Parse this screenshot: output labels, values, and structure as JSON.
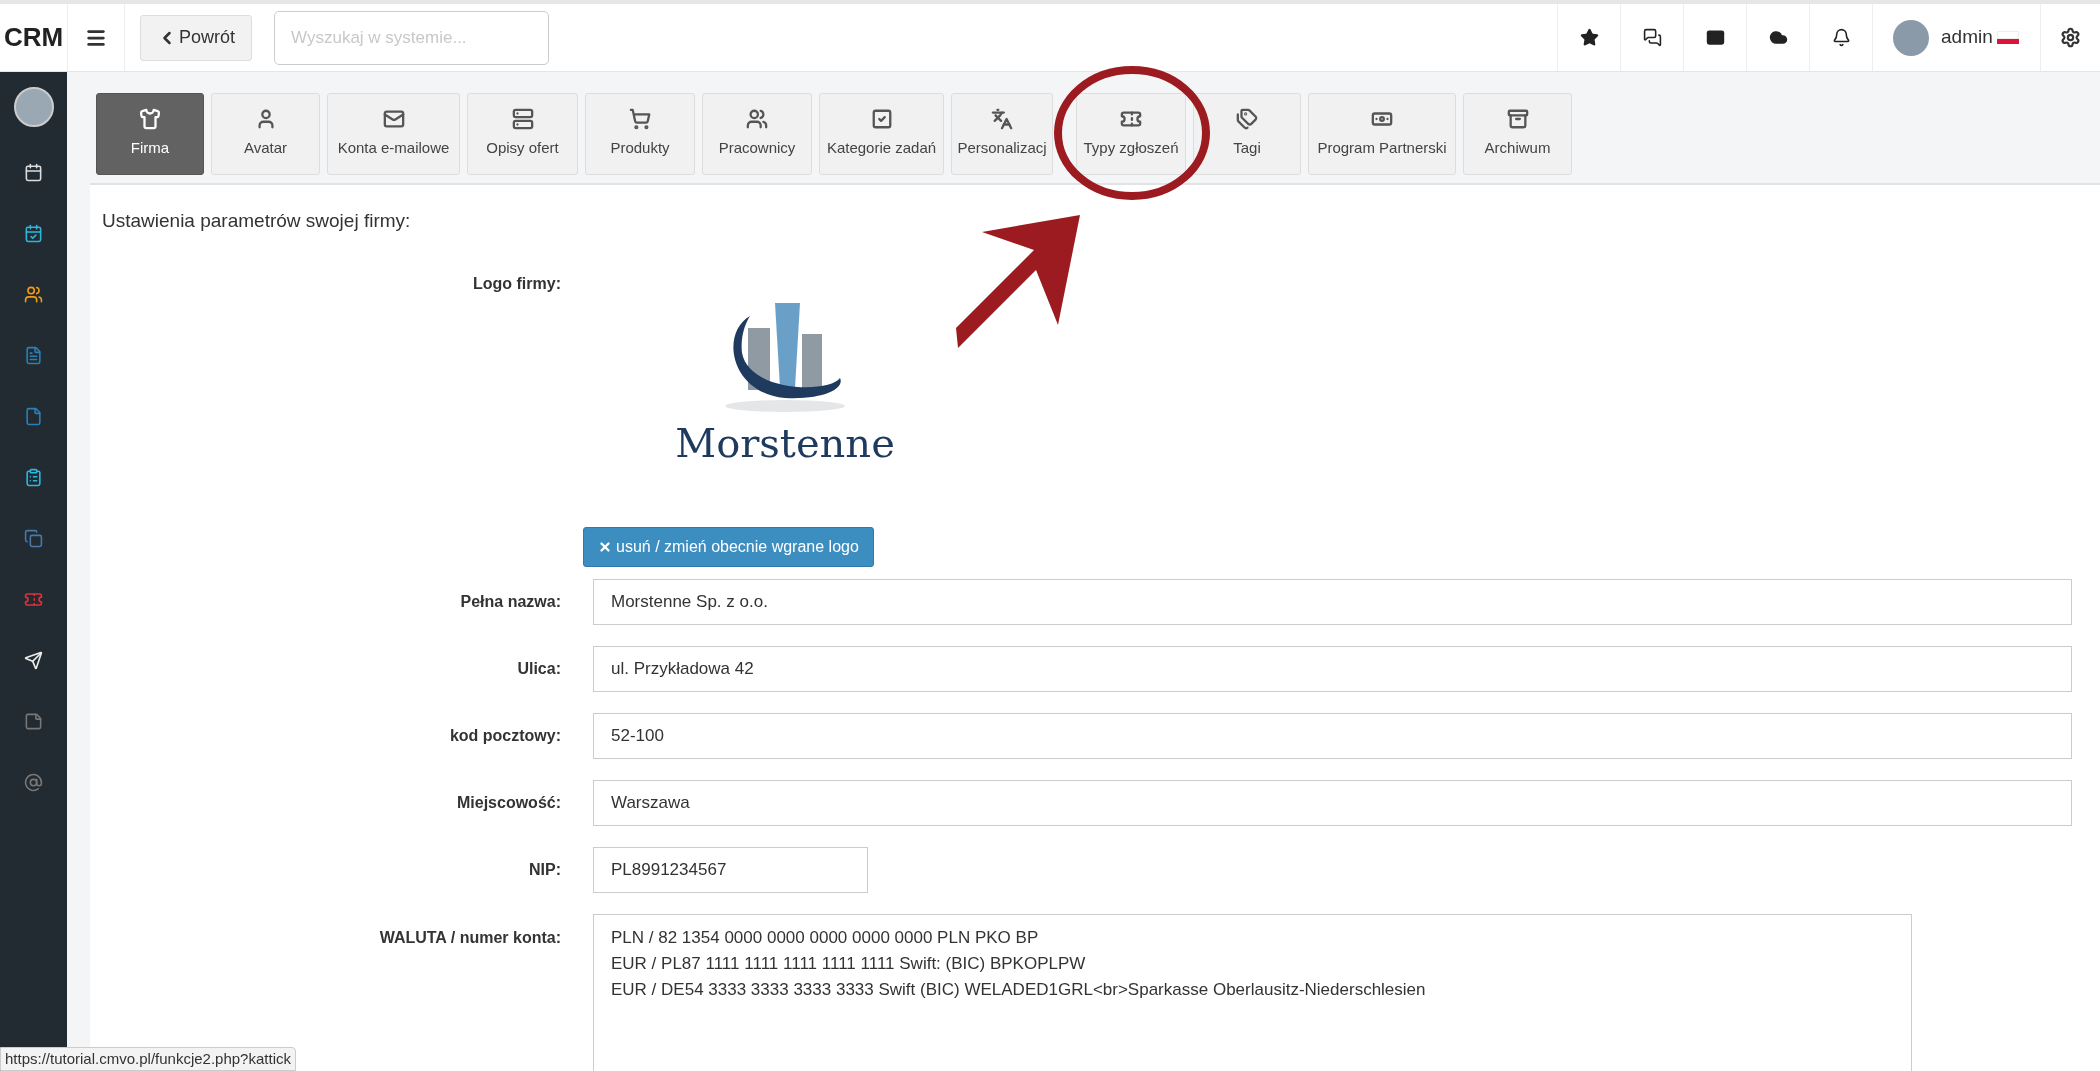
{
  "header": {
    "brand": "CRM",
    "back_button": "Powrót",
    "search": {
      "placeholder": "Wyszukaj w systemie..."
    },
    "user": {
      "name": "admin"
    }
  },
  "tabs": [
    {
      "label": "Firma",
      "selected": true
    },
    {
      "label": "Avatar",
      "selected": false
    },
    {
      "label": "Konta e-mailowe",
      "selected": false
    },
    {
      "label": "Opisy ofert",
      "selected": false
    },
    {
      "label": "Produkty",
      "selected": false
    },
    {
      "label": "Pracownicy",
      "selected": false
    },
    {
      "label": "Kategorie zadań",
      "selected": false
    },
    {
      "label": "Personalizacj",
      "selected": false
    },
    {
      "label": "Typy zgłoszeń",
      "selected": false
    },
    {
      "label": "Tagi",
      "selected": false
    },
    {
      "label": "Program Partnerski",
      "selected": false
    },
    {
      "label": "Archiwum",
      "selected": false
    }
  ],
  "panel": {
    "title": "Ustawienia parametrów swojej firmy:",
    "logo_label": "Logo firmy:",
    "logo_text": "Morstenne",
    "logo_button": "usuń / zmień obecnie wgrane logo",
    "fields": [
      {
        "label": "Pełna nazwa:",
        "value": "Morstenne Sp. z o.o.",
        "kind": "wide"
      },
      {
        "label": "Ulica:",
        "value": "ul. Przykładowa 42",
        "kind": "wide"
      },
      {
        "label": "kod pocztowy:",
        "value": "52-100",
        "kind": "wide"
      },
      {
        "label": "Miejscowość:",
        "value": "Warszawa",
        "kind": "wide"
      },
      {
        "label": "NIP:",
        "value": "PL8991234567",
        "kind": "short"
      }
    ],
    "accounts": {
      "label": "WALUTA / numer konta:",
      "lines": [
        "PLN / 82 1354 0000 0000 0000 0000 0000 PLN PKO BP",
        "EUR / PL87 1111 1111 1111 1111 1111 Swift: (BIC) BPKOPLPW",
        "EUR / DE54 3333 3333 3333 3333 Swift (BIC) WELADED1GRL<br>Sparkasse Oberlausitz-Niederschlesien"
      ]
    }
  },
  "status_bar": {
    "url": "https://tutorial.cmvo.pl/funkcje2.php?kattick"
  }
}
